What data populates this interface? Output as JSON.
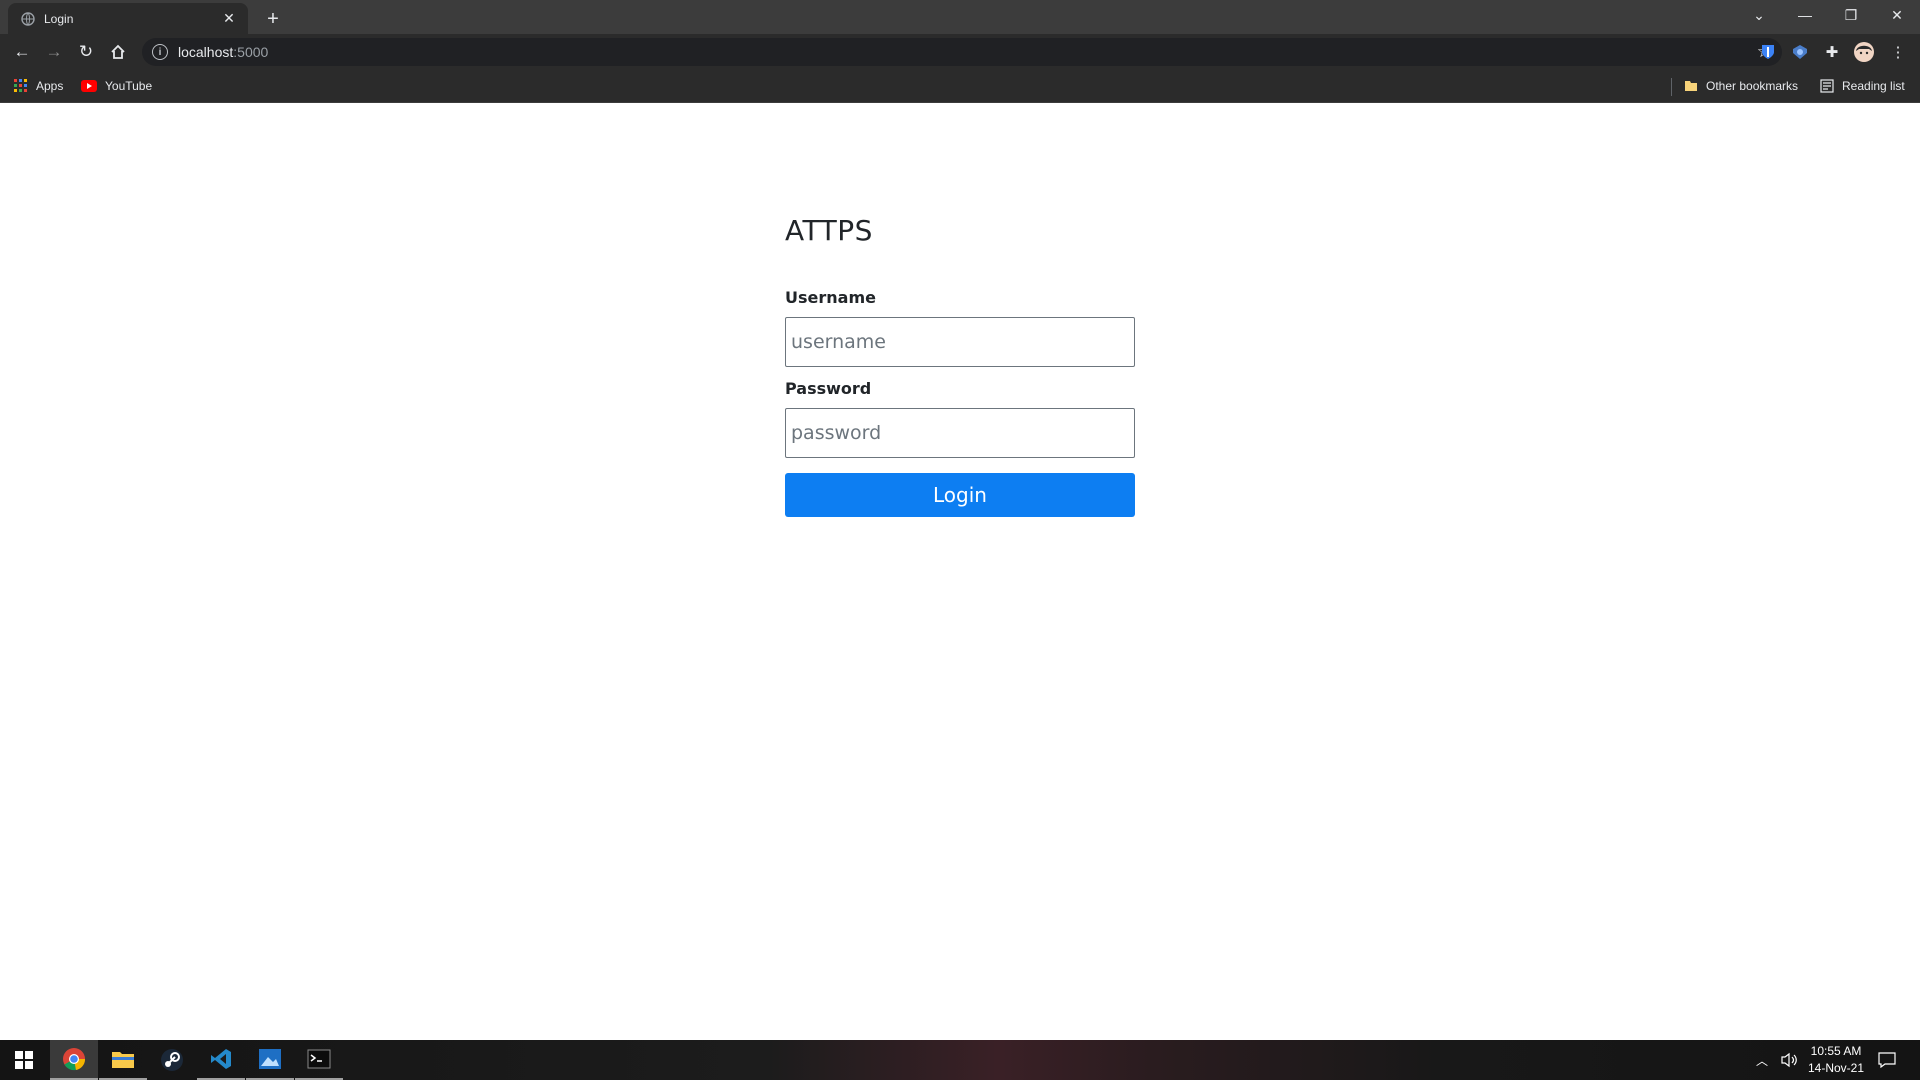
{
  "browser": {
    "tab_title": "Login",
    "tab_close": "✕",
    "new_tab": "+",
    "address_host": "localhost",
    "address_port": ":5000",
    "bookmarks": {
      "apps": "Apps",
      "youtube": "YouTube",
      "other": "Other bookmarks",
      "reading_list": "Reading list"
    }
  },
  "page": {
    "heading": "ATTPS",
    "username_label": "Username",
    "username_placeholder": "username",
    "password_label": "Password",
    "password_placeholder": "password",
    "login_button": "Login"
  },
  "taskbar": {
    "time": "10:55 AM",
    "date": "14-Nov-21"
  },
  "colors": {
    "primary": "#0d7ef2",
    "chrome_dark": "#2b2b2b"
  }
}
